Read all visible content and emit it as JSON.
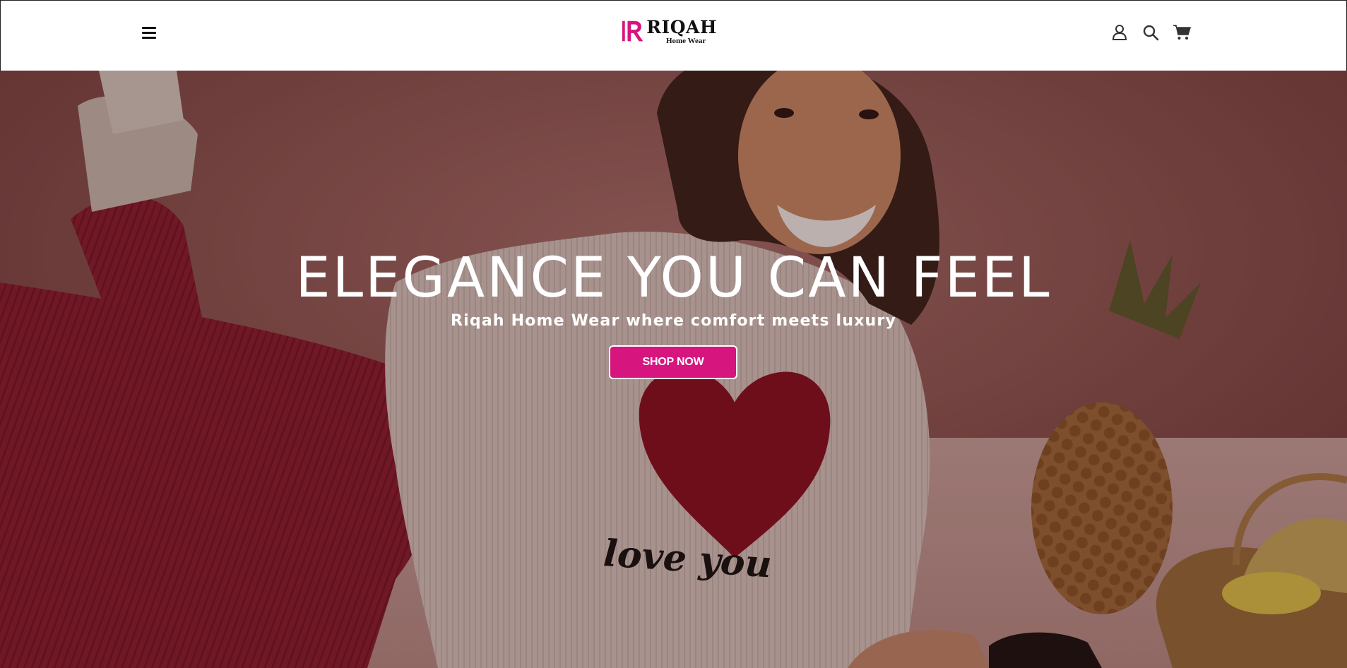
{
  "header": {
    "brand_name": "RIQAH",
    "brand_sub": "Home Wear",
    "icons": [
      "menu-icon",
      "user-icon",
      "search-icon",
      "cart-icon"
    ]
  },
  "hero": {
    "title": "ELEGANCE YOU CAN FEEL",
    "subtitle": "Riqah Home Wear where comfort meets luxury",
    "cta_label": "SHOP NOW",
    "shirt_text": "love you"
  },
  "colors": {
    "accent": "#d6157f",
    "header_bg": "#ffffff",
    "hero_bg": "#7a4340"
  }
}
